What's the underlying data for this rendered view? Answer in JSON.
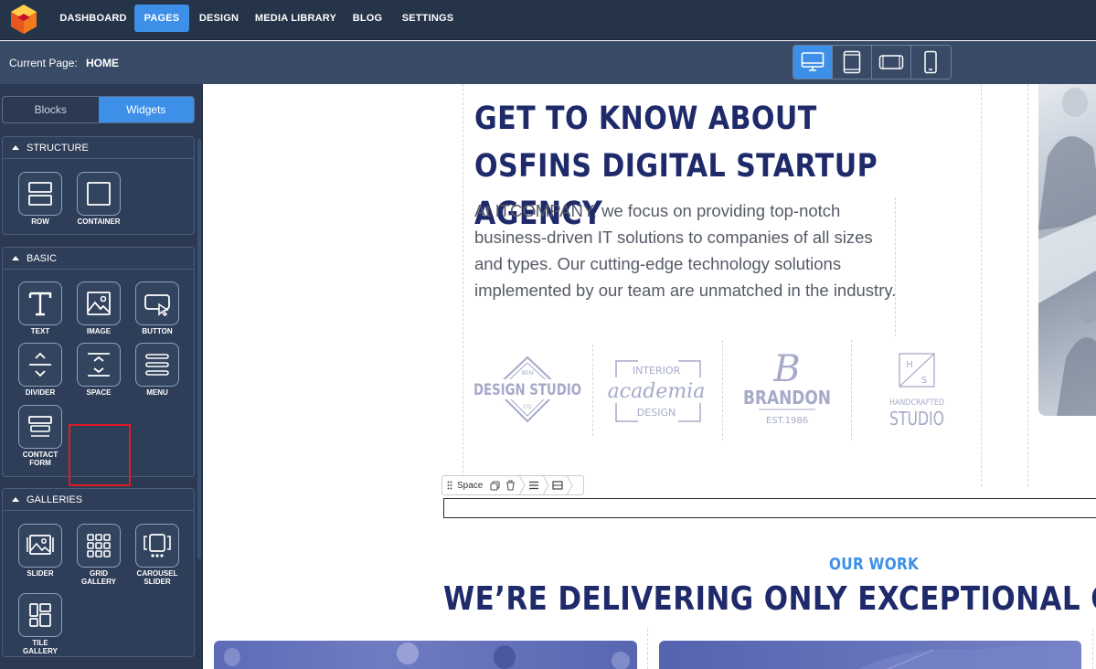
{
  "nav": {
    "items": [
      {
        "label": "DASHBOARD"
      },
      {
        "label": "PAGES"
      },
      {
        "label": "DESIGN"
      },
      {
        "label": "MEDIA LIBRARY"
      },
      {
        "label": "BLOG"
      },
      {
        "label": "SETTINGS"
      }
    ],
    "active": "PAGES"
  },
  "subbar": {
    "current_page_label": "Current Page:",
    "current_page_value": "HOME",
    "devices": [
      "desktop-icon",
      "tablet-icon",
      "tablet-landscape-icon",
      "mobile-icon"
    ],
    "active_device": "desktop-icon"
  },
  "sidebar": {
    "tabs": [
      {
        "label": "Blocks"
      },
      {
        "label": "Widgets"
      }
    ],
    "active_tab": "Widgets",
    "panels": {
      "structure": {
        "title": "STRUCTURE",
        "widgets": [
          {
            "label": "ROW",
            "icon": "row-icon"
          },
          {
            "label": "CONTAINER",
            "icon": "container-icon"
          }
        ]
      },
      "basic": {
        "title": "BASIC",
        "widgets": [
          {
            "label": "TEXT",
            "icon": "text-icon"
          },
          {
            "label": "IMAGE",
            "icon": "image-icon"
          },
          {
            "label": "BUTTON",
            "icon": "button-icon"
          },
          {
            "label": "DIVIDER",
            "icon": "divider-icon"
          },
          {
            "label": "SPACE",
            "icon": "space-icon"
          },
          {
            "label": "MENU",
            "icon": "menu-icon"
          },
          {
            "label": "CONTACT FORM",
            "icon": "contact-form-icon"
          }
        ],
        "highlighted": "SPACE"
      },
      "galleries": {
        "title": "GALLERIES",
        "widgets": [
          {
            "label": "SLIDER",
            "icon": "slider-icon"
          },
          {
            "label": "GRID GALLERY",
            "icon": "grid-gallery-icon"
          },
          {
            "label": "CAROUSEL SLIDER",
            "icon": "carousel-slider-icon"
          },
          {
            "label": "TILE GALLERY",
            "icon": "tile-gallery-icon"
          }
        ]
      }
    }
  },
  "canvas": {
    "about_title": "GET TO KNOW ABOUT OSFINS DIGITAL STARTUP AGENCY",
    "about_text": "At ITCOMPANY, we focus on providing top-notch business-driven IT solutions to companies of all sizes and types. Our cutting-edge technology solutions implemented by our team are unmatched in the industry.",
    "logos": [
      {
        "lines": [
          "BEN",
          "DESIGN STUDIO",
          "CO"
        ]
      },
      {
        "lines": [
          "INTERIOR",
          "academia",
          "DESIGN"
        ]
      },
      {
        "lines": [
          "B",
          "BRANDON",
          "EST.1986"
        ]
      },
      {
        "lines": [
          "H",
          "S",
          "HANDCRAFTED",
          "STUDIO"
        ]
      }
    ],
    "space_toolbar": {
      "label": "Space"
    },
    "our_work": "OUR WORK",
    "delivering": "WE’RE DELIVERING ONLY EXCEPTIONAL QU"
  },
  "colors": {
    "topbar": "#26344a",
    "subbar": "#394a66",
    "sidebar": "#2b3a52",
    "accent": "#3d8fe8",
    "heading": "#1f2a6b",
    "highlight": "#e01b24"
  }
}
